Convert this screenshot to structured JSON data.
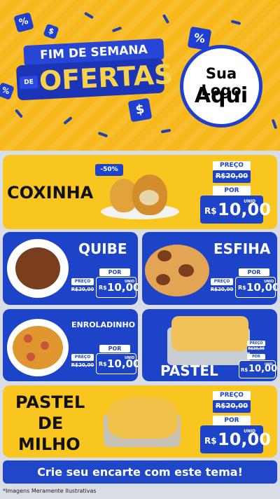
{
  "header": {
    "title_top": "FIM DE SEMANA",
    "title_de": "DE",
    "title_main": "OFERTAS",
    "logo_line1": "Sua Logo",
    "logo_line2": "Aqui"
  },
  "products": [
    {
      "name": "COXINHA",
      "badge": "-50%",
      "preco_label": "PREÇO",
      "old_price": "R$20,00",
      "por_label": "POR",
      "currency": "R$",
      "new_price": "10,00",
      "unid": "UNID"
    },
    {
      "name": "QUIBE",
      "preco_label": "PREÇO",
      "old_price": "R$20,00",
      "por_label": "POR",
      "currency": "R$",
      "new_price": "10,00",
      "unid": "UNID"
    },
    {
      "name": "ESFIHA",
      "preco_label": "PREÇO",
      "old_price": "R$20,00",
      "por_label": "POR",
      "currency": "R$",
      "new_price": "10,00",
      "unid": "UNID"
    },
    {
      "name": "ENROLADINHO",
      "preco_label": "PREÇO",
      "old_price": "R$20,00",
      "por_label": "POR",
      "currency": "R$",
      "new_price": "10,00",
      "unid": "UNID"
    },
    {
      "name": "PASTEL",
      "preco_label": "PREÇO",
      "old_price": "R$20,00",
      "por_label": "POR",
      "currency": "R$",
      "new_price": "10,00",
      "unid": "UNID"
    },
    {
      "name_line1": "PASTEL",
      "name_line2": "DE",
      "name_line3": "MILHO",
      "preco_label": "PREÇO",
      "old_price": "R$20,00",
      "por_label": "POR",
      "currency": "R$",
      "new_price": "10,00",
      "unid": "UNID"
    }
  ],
  "footer": {
    "cta": "Crie seu encarte com este tema!",
    "disclaimer": "*Imagens Meramente Ilustrativas"
  },
  "colors": {
    "yellow": "#f8c61f",
    "blue": "#1d44c8",
    "background": "#d9dde6"
  }
}
